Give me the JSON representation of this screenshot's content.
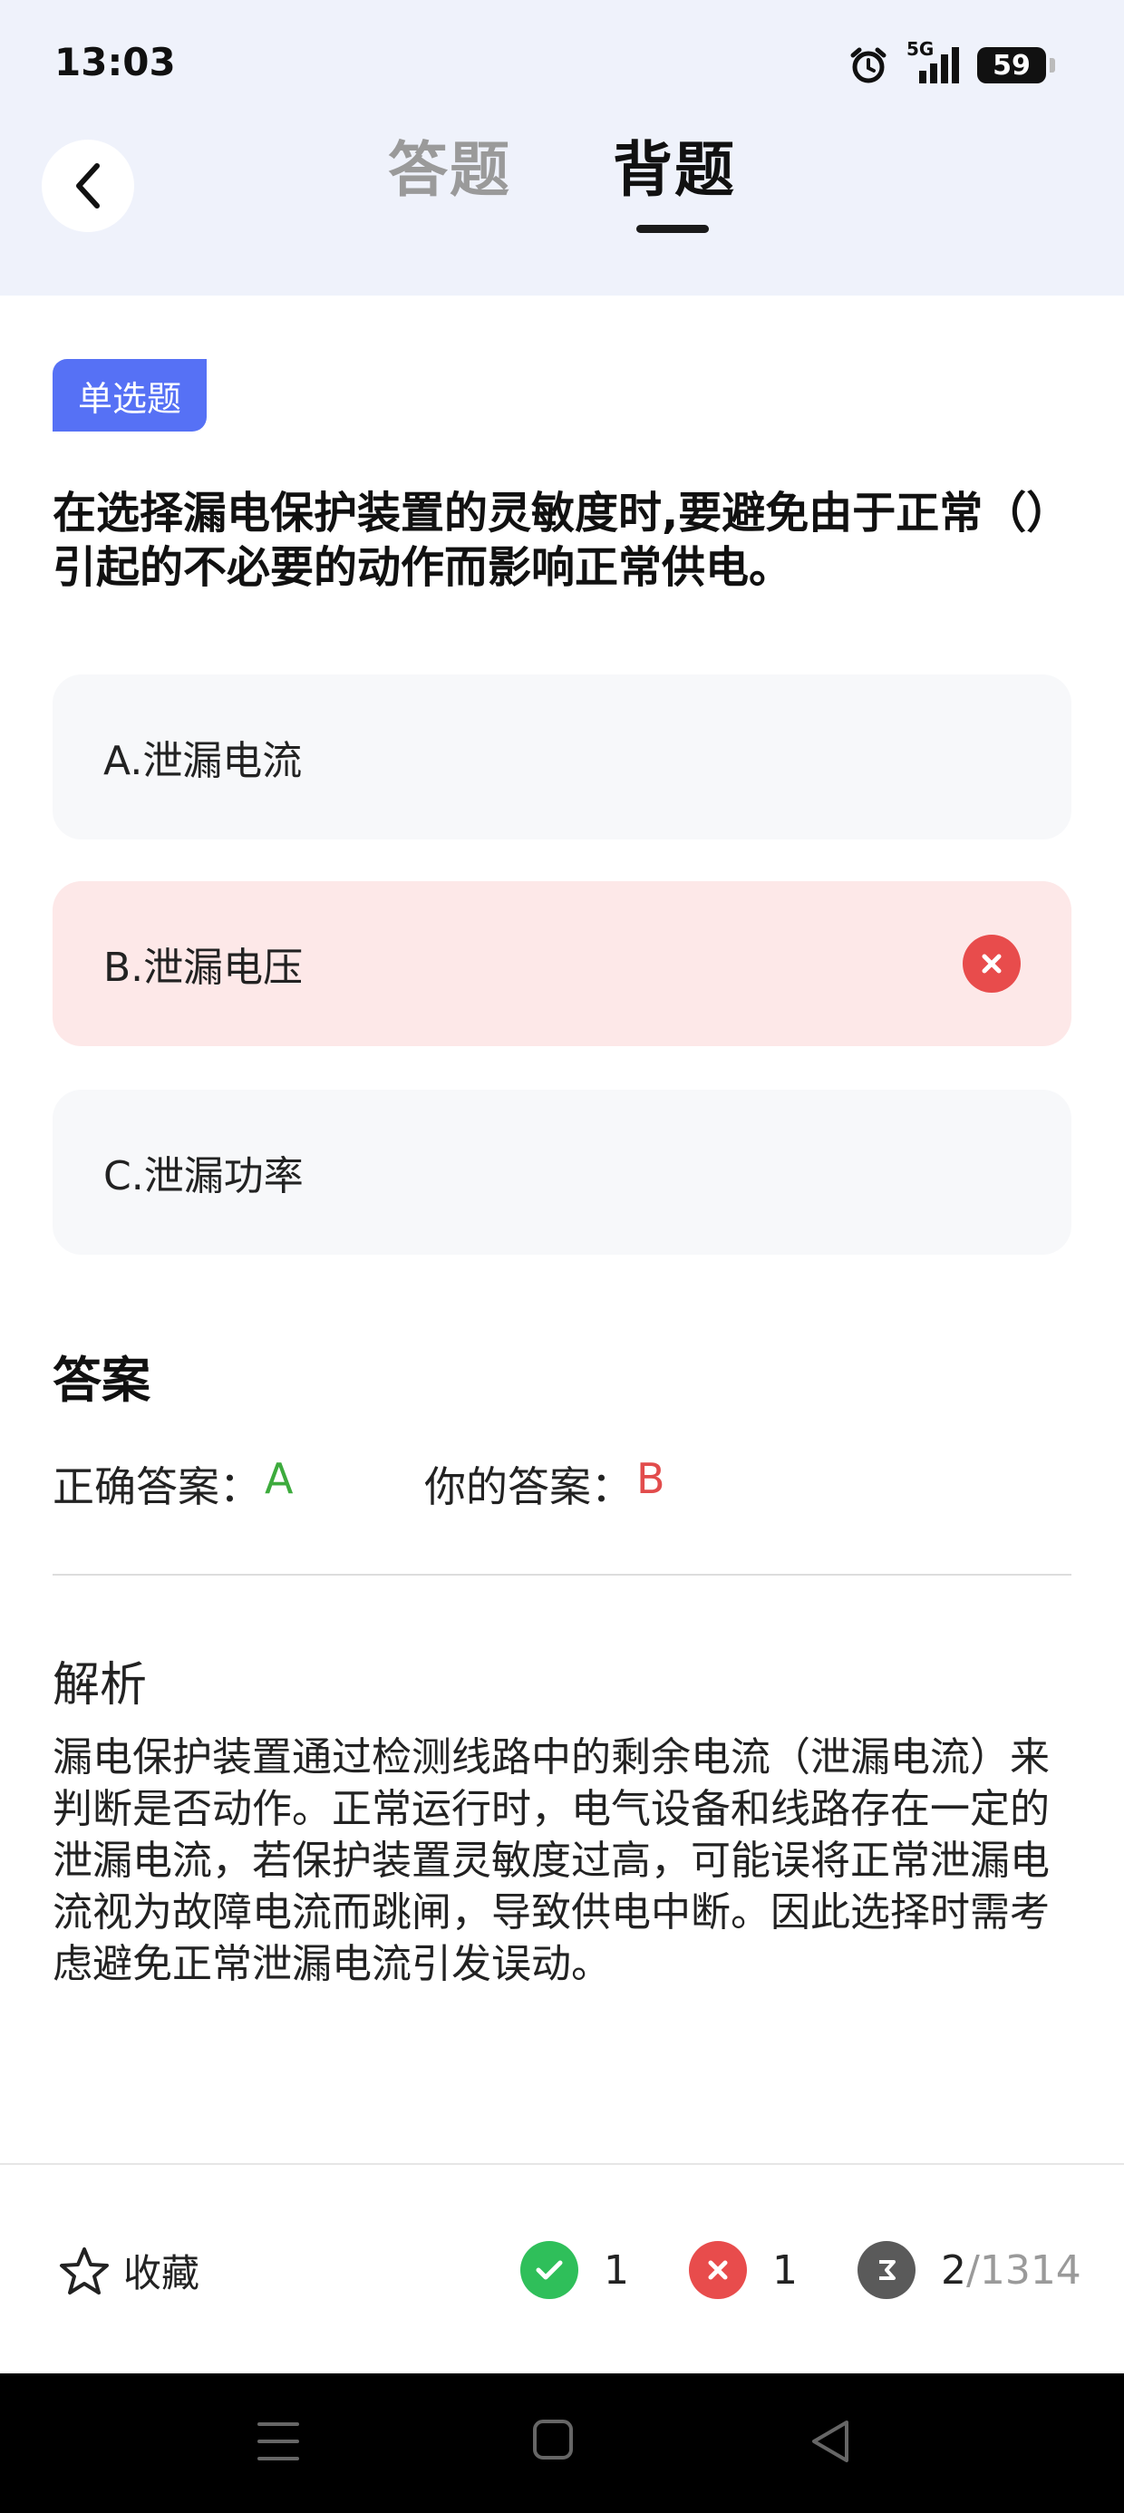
{
  "status_bar": {
    "time": "13:03",
    "network": "5G",
    "battery": "59"
  },
  "header": {
    "tabs": [
      {
        "label": "答题",
        "active": false
      },
      {
        "label": "背题",
        "active": true
      }
    ]
  },
  "question": {
    "type": "单选题",
    "text": "在选择漏电保护装置的灵敏度时,要避免由于正常（）引起的不必要的动作而影响正常供电。",
    "options": [
      {
        "label": "A.泄漏电流",
        "state": "normal"
      },
      {
        "label": "B.泄漏电压",
        "state": "wrong"
      },
      {
        "label": "C.泄漏功率",
        "state": "normal"
      }
    ]
  },
  "answer": {
    "title": "答案",
    "correct_label": "正确答案：",
    "correct_value": "A",
    "yours_label": "你的答案：",
    "yours_value": "B"
  },
  "analysis": {
    "title": "解析",
    "text": "漏电保护装置通过检测线路中的剩余电流（泄漏电流）来判断是否动作。正常运行时，电气设备和线路存在一定的泄漏电流，若保护装置灵敏度过高，可能误将正常泄漏电流视为故障电流而跳闸，导致供电中断。因此选择时需考虑避免正常泄漏电流引发误动。"
  },
  "bottom_bar": {
    "favorite_label": "收藏",
    "correct_count": "1",
    "wrong_count": "1",
    "current_index": "2",
    "total": "/1314"
  },
  "colors": {
    "accent": "#5671f5",
    "correct": "#3dab3d",
    "wrong": "#e24c4c",
    "header_bg": "#eff2fb",
    "wrong_option_bg": "#fde8e8"
  }
}
